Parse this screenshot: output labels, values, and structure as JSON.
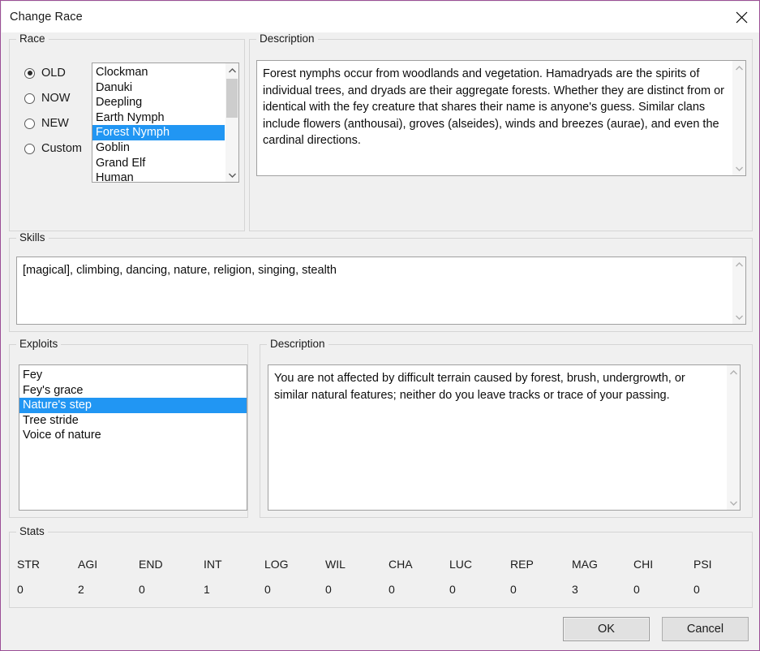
{
  "window": {
    "title": "Change Race",
    "close_icon": "close-icon",
    "border_color": "#9b4f96",
    "accent_color": "#2196f3"
  },
  "race_group": {
    "legend": "Race",
    "radios": [
      {
        "label": "OLD",
        "selected": true
      },
      {
        "label": "NOW",
        "selected": false
      },
      {
        "label": "NEW",
        "selected": false
      },
      {
        "label": "Custom",
        "selected": false
      }
    ],
    "list": {
      "items": [
        "Clockman",
        "Danuki",
        "Deepling",
        "Earth Nymph",
        "Forest Nymph",
        "Goblin",
        "Grand Elf",
        "Human"
      ],
      "selected_index": 4,
      "scrollbar": {
        "up_icon": "chevron-up-icon",
        "down_icon": "chevron-down-icon"
      }
    }
  },
  "race_description_group": {
    "legend": "Description",
    "text": "Forest nymphs occur from woodlands and vegetation. Hamadryads are the spirits of individual trees, and dryads are their aggregate forests. Whether they are distinct from or identical with the fey creature that shares their name is anyone's guess. Similar clans include flowers (anthousai), groves (alseides), winds and breezes (aurae), and even the cardinal directions.",
    "scrollbar": {
      "up_icon": "chevron-up-icon",
      "down_icon": "chevron-down-icon"
    }
  },
  "skills_group": {
    "legend": "Skills",
    "text": "[magical], climbing, dancing, nature, religion, singing, stealth",
    "scrollbar": {
      "up_icon": "chevron-up-icon",
      "down_icon": "chevron-down-icon"
    }
  },
  "exploits_group": {
    "legend": "Exploits",
    "list": {
      "items": [
        "Fey",
        "Fey's grace",
        "Nature's step",
        "Tree stride",
        "Voice of nature"
      ],
      "selected_index": 2
    }
  },
  "exploit_description_group": {
    "legend": "Description",
    "text": "You are not affected by difficult terrain caused by forest, brush, undergrowth, or similar natural features; neither do you leave tracks or trace of your passing.",
    "scrollbar": {
      "up_icon": "chevron-up-icon",
      "down_icon": "chevron-down-icon"
    }
  },
  "stats_group": {
    "legend": "Stats",
    "columns": [
      {
        "name": "STR",
        "value": "0"
      },
      {
        "name": "AGI",
        "value": "2"
      },
      {
        "name": "END",
        "value": "0"
      },
      {
        "name": "INT",
        "value": "1"
      },
      {
        "name": "LOG",
        "value": "0"
      },
      {
        "name": "WIL",
        "value": "0"
      },
      {
        "name": "CHA",
        "value": "0"
      },
      {
        "name": "LUC",
        "value": "0"
      },
      {
        "name": "REP",
        "value": "0"
      },
      {
        "name": "MAG",
        "value": "3"
      },
      {
        "name": "CHI",
        "value": "0"
      },
      {
        "name": "PSI",
        "value": "0"
      }
    ]
  },
  "buttons": {
    "ok": "OK",
    "cancel": "Cancel"
  }
}
